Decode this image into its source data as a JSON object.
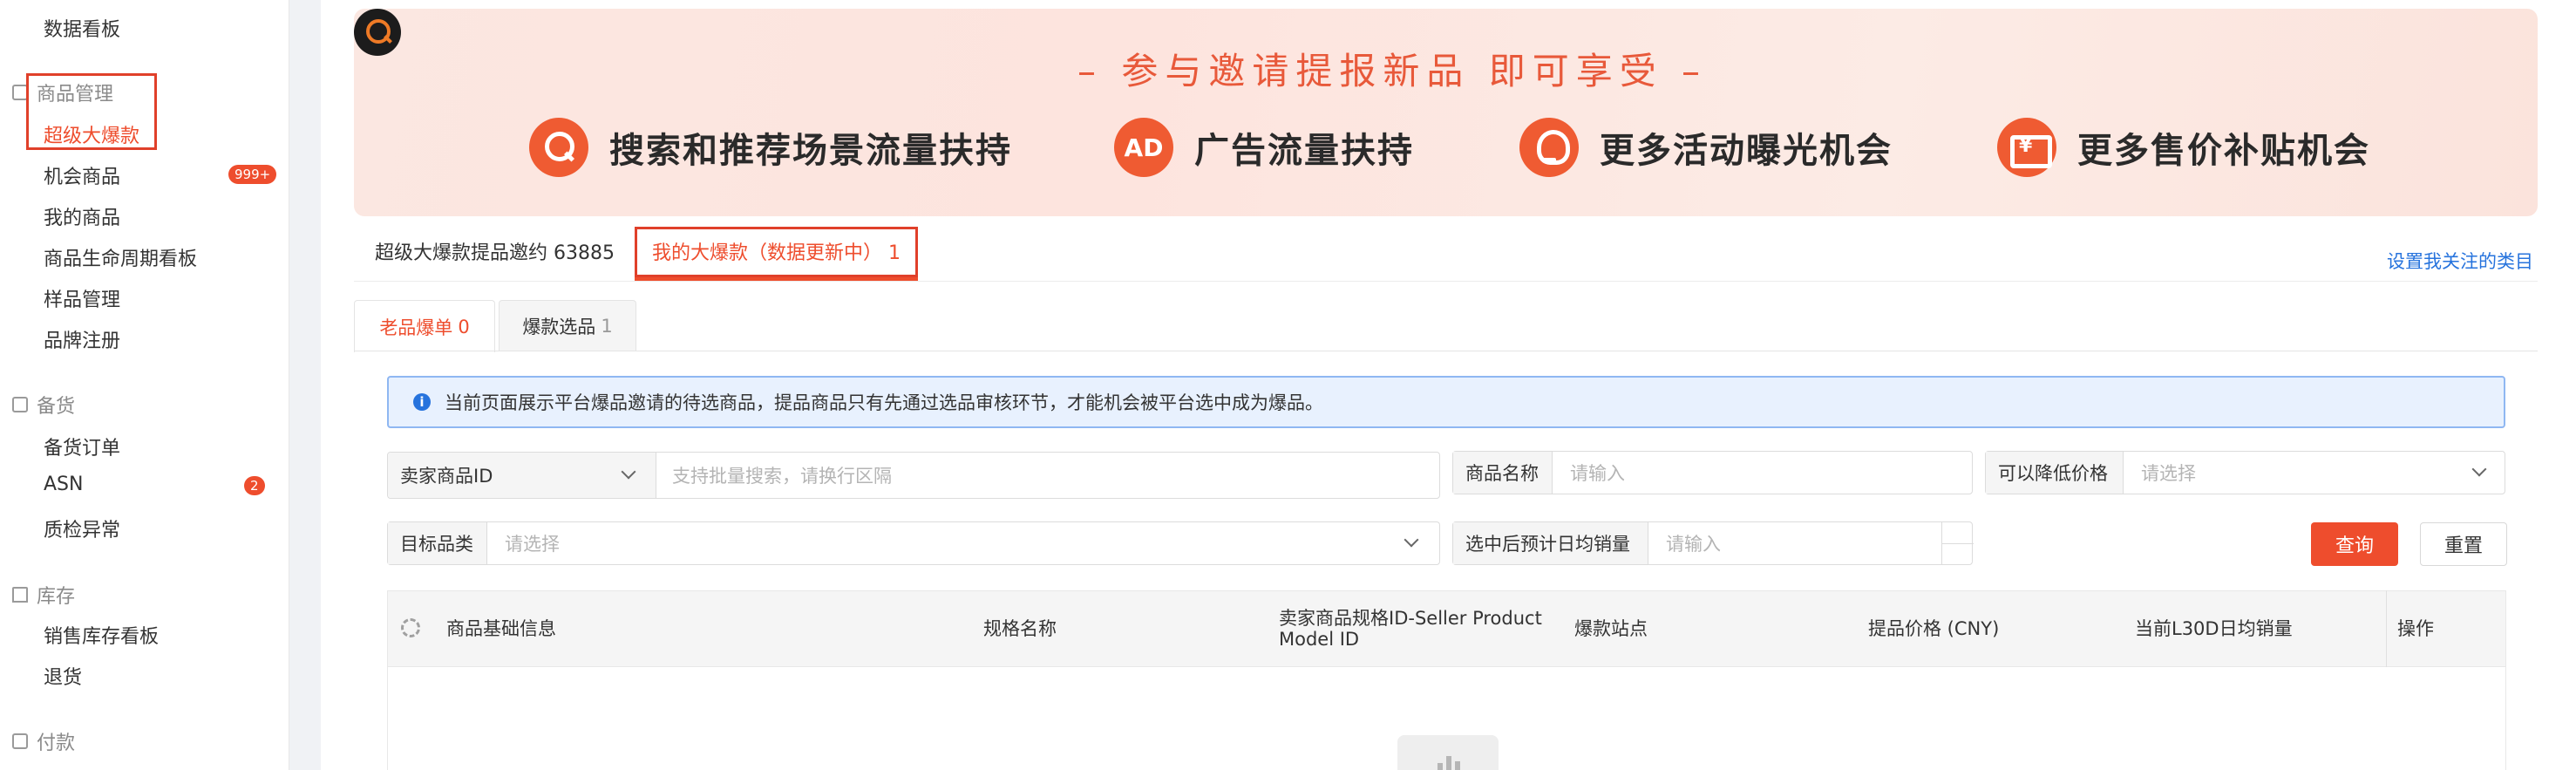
{
  "sidebar": {
    "top_item": "数据看板",
    "groups": [
      {
        "label": "商品管理",
        "items": [
          {
            "label": "超级大爆款",
            "active": true
          },
          {
            "label": "机会商品",
            "badge": "999+"
          },
          {
            "label": "我的商品"
          },
          {
            "label": "商品生命周期看板"
          },
          {
            "label": "样品管理"
          },
          {
            "label": "品牌注册"
          }
        ]
      },
      {
        "label": "备货",
        "items": [
          {
            "label": "备货订单"
          },
          {
            "label": "ASN",
            "badge": "2"
          },
          {
            "label": "质检异常"
          }
        ]
      },
      {
        "label": "库存",
        "items": [
          {
            "label": "销售库存看板"
          },
          {
            "label": "退货"
          }
        ]
      },
      {
        "label": "付款",
        "items": []
      }
    ]
  },
  "banner": {
    "title": "– 参与邀请提报新品  即可享受 –",
    "features": [
      {
        "icon": "search-icon",
        "text": "搜索和推荐场景流量扶持"
      },
      {
        "icon": "ad-icon",
        "icon_text": "AD",
        "text": "广告流量扶持"
      },
      {
        "icon": "bulb-icon",
        "text": "更多活动曝光机会"
      },
      {
        "icon": "ticket-icon",
        "text": "更多售价补贴机会"
      }
    ]
  },
  "tabs": {
    "invite_label": "超级大爆款提品邀约 63885",
    "mine_label": "我的大爆款（数据更新中） 1",
    "right_link": "设置我关注的类目"
  },
  "subtabs": [
    {
      "label": "老品爆单",
      "count": "0",
      "active": true
    },
    {
      "label": "爆款选品",
      "count": "1",
      "active": false
    }
  ],
  "notice": {
    "icon": "info-icon",
    "text": "当前页面展示平台爆品邀请的待选商品，提品商品只有先通过选品审核环节，才能机会被平台选中成为爆品。"
  },
  "filters": {
    "seller_id": {
      "label": "卖家商品ID",
      "placeholder": "支持批量搜索，请换行区隔"
    },
    "product_name": {
      "label": "商品名称",
      "placeholder": "请输入"
    },
    "lower_price": {
      "label": "可以降低价格",
      "placeholder": "请选择"
    },
    "target_category": {
      "label": "目标品类",
      "placeholder": "请选择"
    },
    "daily_sales": {
      "label": "选中后预计日均销量",
      "placeholder": "请输入"
    },
    "query_button": "查询",
    "reset_button": "重置"
  },
  "table": {
    "columns": [
      "商品基础信息",
      "规格名称",
      "卖家商品规格ID-Seller Product Model ID",
      "爆款站点",
      "提品价格 (CNY)",
      "当前L30D日均销量",
      "操作"
    ],
    "rows": []
  },
  "colors": {
    "accent": "#ee4d2d",
    "link": "#2673dd",
    "notice_bg": "#e8f1fe"
  }
}
